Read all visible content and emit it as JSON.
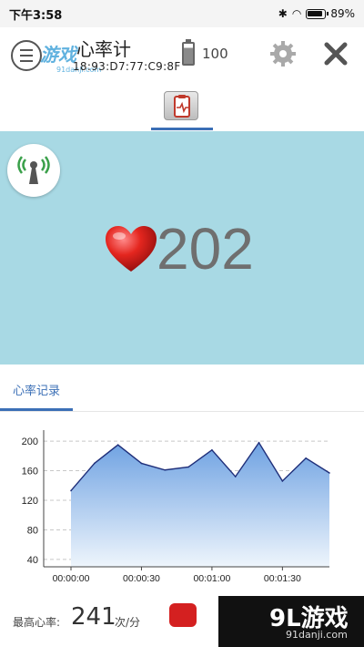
{
  "status_bar": {
    "time": "下午3:58",
    "battery": "89%"
  },
  "header": {
    "watermark_logo": "游戏",
    "watermark_sub": "91danji.com",
    "title": "心率计",
    "device_id": "18:93:D7:77:C9:8F",
    "battery_level": "100"
  },
  "heart_rate": {
    "value": "202"
  },
  "record_tab": {
    "label": "心率记录"
  },
  "chart_data": {
    "type": "area",
    "title": "",
    "xlabel": "",
    "ylabel": "",
    "x": [
      "00:00:00",
      "00:00:10",
      "00:00:20",
      "00:00:30",
      "00:00:40",
      "00:00:50",
      "00:01:00",
      "00:01:10",
      "00:01:20",
      "00:01:30",
      "00:01:40",
      "00:01:50"
    ],
    "values": [
      133,
      170,
      195,
      170,
      161,
      165,
      188,
      152,
      198,
      146,
      177,
      157
    ],
    "yticks": [
      "200",
      "160",
      "120",
      "80",
      "40"
    ],
    "ytick_values": [
      200,
      160,
      120,
      80,
      40
    ],
    "xticks": [
      "00:00:00",
      "00:00:30",
      "00:01:00",
      "00:01:30"
    ],
    "xtick_index": [
      0,
      3,
      6,
      9
    ],
    "ylim": [
      30,
      210
    ],
    "grid": true,
    "line_color": "#1f2f7a",
    "fill_top": "#6fa2e2",
    "fill_bottom": "#eef5fc"
  },
  "footer": {
    "max_label": "最高心率:",
    "max_value": "241",
    "max_unit": "次/分",
    "watermark_big": "9L游戏",
    "watermark_small": "91danji.com"
  },
  "colors": {
    "accent": "#3b6fb6",
    "hero_bg": "#a8d9e4"
  }
}
